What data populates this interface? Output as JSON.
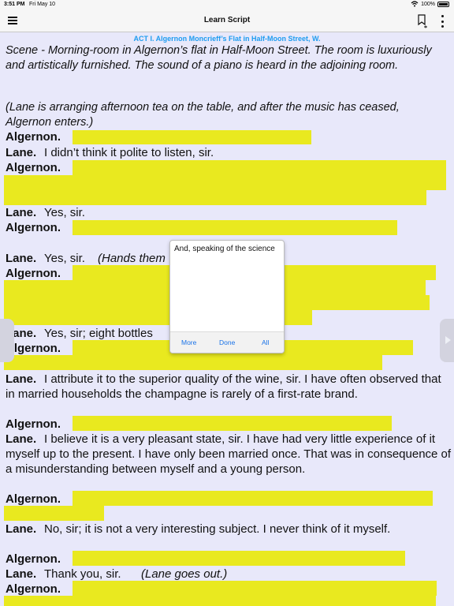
{
  "status": {
    "time": "3:51 PM",
    "date": "Fri May 10",
    "battery": "100%"
  },
  "nav": {
    "title": "Learn Script"
  },
  "script": {
    "act_title": "ACT I. Algernon Moncrieff’s Flat in Half-Moon Street, W.",
    "scene": "Scene - Morning-room in Algernon’s flat in Half-Moon Street.  The room is luxuriously and artistically furnished.  The sound of a piano is heard in the adjoining room.",
    "stage_open": "(Lane is arranging afternoon tea on the table, and after the music has ceased, Algernon enters.)",
    "speaker_algernon": "Algernon.",
    "speaker_lane": "Lane.",
    "lines": {
      "l1": "I didn’t think it polite to listen, sir.",
      "l2": "Yes, sir.",
      "l3": "Yes, sir.",
      "l3_stage": "(Hands them",
      "l4": "Yes, sir; eight bottles",
      "l5": "I attribute it to the superior quality of the wine, sir.  I have often observed that in married households the champagne is rarely of a first-rate brand.",
      "l6": "I believe it is a very pleasant state, sir.  I have had very little experience of it myself up to the present.  I have only been married once.  That was in consequence of a misunderstanding between myself and a young person.",
      "l7": "No, sir; it is not a very interesting subject.  I never think of it myself.",
      "l8": "Thank you, sir.",
      "l8_stage": "(Lane goes out.)"
    }
  },
  "popup": {
    "text": "And, speaking of the science",
    "more": "More",
    "done": "Done",
    "all": "All"
  },
  "colors": {
    "highlight": "#e9e91f",
    "act_title": "#1e9cf0",
    "background": "#e8e8fa",
    "link": "#1a73e8"
  }
}
